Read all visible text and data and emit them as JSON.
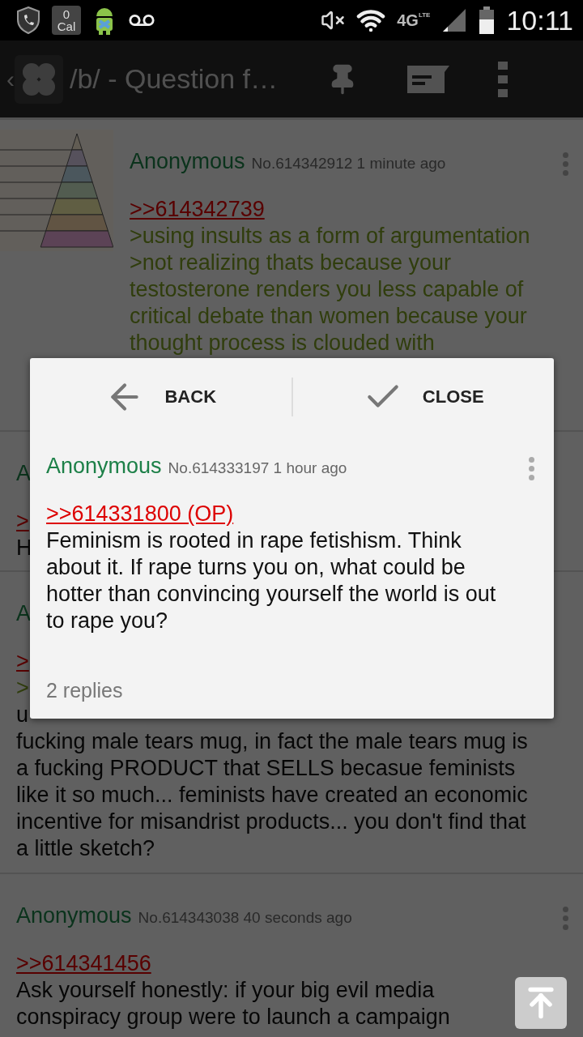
{
  "status_bar": {
    "calendar_count": "0",
    "calendar_label": "Cal",
    "network": "4G",
    "network_sub": "LTE",
    "time": "10:11"
  },
  "action_bar": {
    "back": "‹",
    "title": "/b/ - Question f…"
  },
  "posts": [
    {
      "thumbnail": {
        "kind": "picture"
      },
      "name": "Anonymous",
      "meta": "No.614342912 1 minute ago",
      "body": [
        {
          "kind": "link",
          "text": ">>614342739"
        },
        {
          "kind": "quote",
          "text": ">using insults as a form of argumentation"
        },
        {
          "kind": "quote",
          "text": ">not realizing thats because your\ntestosterone renders you less capable of\ncritical debate than women because your\nthought process is clouded with"
        }
      ]
    },
    {
      "name": "A",
      "body": [
        {
          "kind": "link",
          "text": ">"
        },
        {
          "kind": "text",
          "text": "H"
        }
      ]
    },
    {
      "name": "A",
      "body": [
        {
          "kind": "link",
          "text": ">"
        },
        {
          "kind": "quote",
          "text": ">"
        },
        {
          "kind": "text",
          "text": "u"
        },
        {
          "kind": "text",
          "text": "fucking male tears mug, in fact the male tears mug is\na fucking PRODUCT that SELLS becasue feminists\nlike it so much... feminists have created an economic\nincentive for misandrist products... you don't find that\na little sketch?"
        }
      ]
    },
    {
      "name": "Anonymous",
      "meta": "No.614343038 40 seconds ago",
      "body": [
        {
          "kind": "link",
          "text": ">>614341456"
        },
        {
          "kind": "text",
          "text": "Ask yourself honestly: if your big evil media\nconspiracy group were to launch a campaign"
        }
      ]
    }
  ],
  "dialog": {
    "buttons": [
      {
        "kind": "back",
        "label": "BACK"
      },
      {
        "kind": "close",
        "label": "CLOSE"
      }
    ],
    "post": {
      "name": "Anonymous",
      "meta": "No.614333197 1 hour ago",
      "body": [
        {
          "kind": "link",
          "text": ">>614331800 (OP)"
        },
        {
          "kind": "text",
          "text": "Feminism is rooted in rape fetishism. Think\nabout it. If rape turns you on, what could be\nhotter than convincing yourself the world is out\nto rape you?"
        }
      ]
    },
    "replies": "2 replies"
  }
}
